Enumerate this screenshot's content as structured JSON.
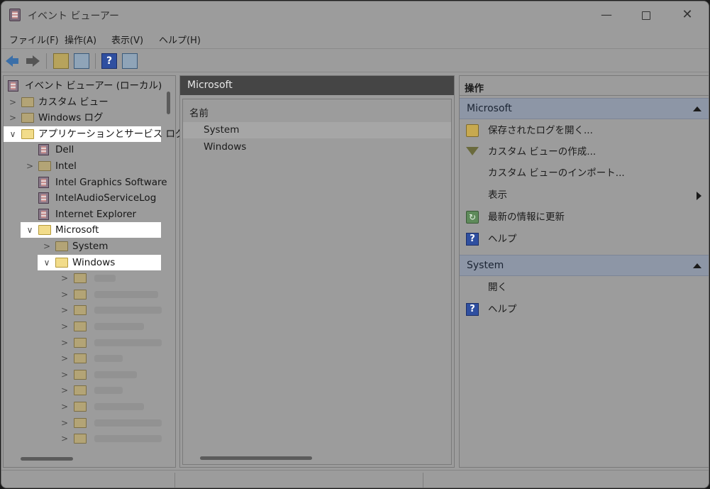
{
  "window": {
    "title": "イベント ビューアー",
    "controls": {
      "minimize": "—",
      "close": "✕"
    }
  },
  "menu": [
    {
      "label": "ファイル(F)"
    },
    {
      "label": "操作(A)"
    },
    {
      "label": "表示(V)"
    },
    {
      "label": "ヘルプ(H)"
    }
  ],
  "toolbar": {
    "buttons": [
      "back-icon",
      "forward-icon",
      "folder-up-icon",
      "console-tree-icon",
      "help-icon",
      "action-pane-icon"
    ],
    "help_glyph": "?"
  },
  "tree": {
    "items": [
      {
        "label": "イベント ビューアー (ローカル)",
        "expander": "",
        "icon": "event-viewer-icon",
        "highlight": false
      },
      {
        "label": "カスタム ビュー",
        "expander": ">",
        "icon": "folder-icon",
        "highlight": false
      },
      {
        "label": "Windows ログ",
        "expander": ">",
        "icon": "folder-icon",
        "highlight": false
      },
      {
        "label": "アプリケーションとサービス ログ",
        "expander": "∨",
        "icon": "folder-open-icon",
        "highlight": true
      },
      {
        "label": "Dell",
        "expander": "",
        "icon": "log-icon",
        "highlight": false
      },
      {
        "label": "Intel",
        "expander": ">",
        "icon": "folder-icon",
        "highlight": false
      },
      {
        "label": "Intel Graphics Software",
        "expander": "",
        "icon": "log-icon",
        "highlight": false
      },
      {
        "label": "IntelAudioServiceLog",
        "expander": "",
        "icon": "log-icon",
        "highlight": false
      },
      {
        "label": "Internet Explorer",
        "expander": "",
        "icon": "log-icon",
        "highlight": false
      },
      {
        "label": "Microsoft",
        "expander": "∨",
        "icon": "folder-open-icon",
        "highlight": true
      },
      {
        "label": "System",
        "expander": ">",
        "icon": "folder-icon",
        "highlight": false
      },
      {
        "label": "Windows",
        "expander": "∨",
        "icon": "folder-open-icon",
        "highlight": true
      }
    ],
    "blurred_children": 12
  },
  "middle": {
    "header": "Microsoft",
    "column_header": "名前",
    "rows": [
      {
        "label": "System",
        "selected": true
      },
      {
        "label": "Windows",
        "selected": false
      }
    ]
  },
  "actions": {
    "title": "操作",
    "sections": [
      {
        "title": "Microsoft",
        "items": [
          {
            "label": "保存されたログを開く...",
            "icon": "open-log-icon"
          },
          {
            "label": "カスタム ビューの作成...",
            "icon": "filter-icon"
          },
          {
            "label": "カスタム ビューのインポート...",
            "icon": ""
          },
          {
            "label": "表示",
            "icon": "",
            "submenu": true
          },
          {
            "label": "最新の情報に更新",
            "icon": "refresh-icon"
          },
          {
            "label": "ヘルプ",
            "icon": "help-icon",
            "submenu": true
          }
        ]
      },
      {
        "title": "System",
        "items": [
          {
            "label": "開く",
            "icon": ""
          },
          {
            "label": "ヘルプ",
            "icon": "help-icon",
            "submenu": true
          }
        ]
      }
    ]
  },
  "colors": {
    "highlight": "#ffffff",
    "section_header": "#8d96a6",
    "mid_header": "#454545"
  }
}
